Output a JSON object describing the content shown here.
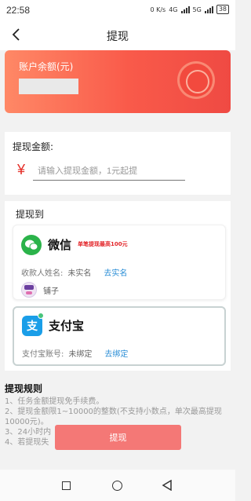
{
  "status_bar": {
    "time": "22:58",
    "speed": "0 K/s",
    "network1": "4G",
    "network2": "5G",
    "battery": "38"
  },
  "nav": {
    "title": "提现"
  },
  "balance": {
    "label": "账户余额(元)"
  },
  "amount": {
    "label": "提现金额:",
    "currency": "¥",
    "placeholder": "请输入提现金额，1元起提"
  },
  "withdraw_to": {
    "label": "提现到",
    "wechat": {
      "name": "微信",
      "limit_tag": "单笔提现最高100元",
      "account_label": "收款人姓名:",
      "account_value": "未实名",
      "action": "去实名",
      "user_name": "铺子",
      "avatar_text": "铺子"
    },
    "alipay": {
      "logo_char": "支",
      "name": "支付宝",
      "account_label": "支付宝账号:",
      "account_value": "未绑定",
      "action": "去绑定"
    }
  },
  "rules": {
    "title": "提现规则",
    "items": [
      "1、任务金额提现免手续费。",
      "2、提现金额限1~10000的整数(不支持小数点，单次最高提现10000元)。",
      "3、24小时内",
      "4、若提现失"
    ]
  },
  "submit": {
    "label": "提现",
    "color": "#f47876"
  },
  "colors": {
    "accent": "#e52d27",
    "link": "#2a8ed6",
    "wechat": "#2bb34a",
    "alipay": "#1a9ee8"
  }
}
